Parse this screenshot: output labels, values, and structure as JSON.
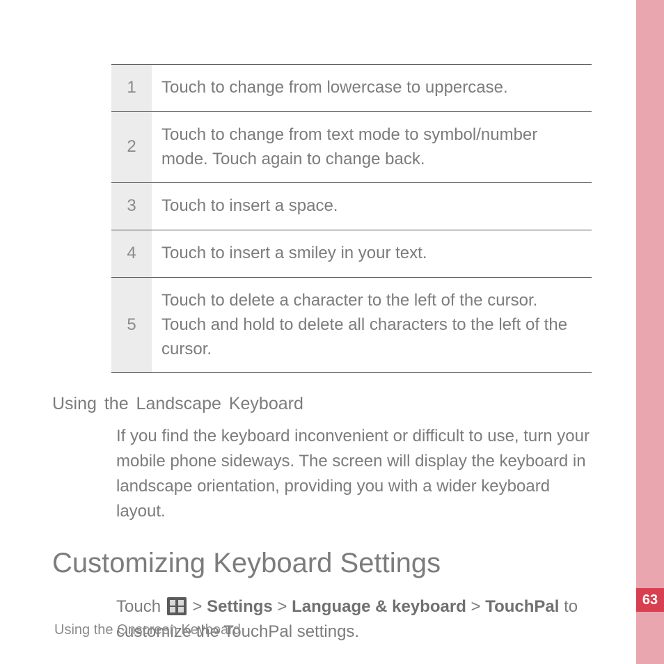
{
  "table": {
    "rows": [
      {
        "num": "1",
        "text": "Touch to change from lowercase to uppercase."
      },
      {
        "num": "2",
        "text": "Touch to change from text mode to symbol/number mode. Touch again to change back."
      },
      {
        "num": "3",
        "text": "Touch to insert a space."
      },
      {
        "num": "4",
        "text": "Touch to insert a smiley in your text."
      },
      {
        "num": "5",
        "text": "Touch to delete a character to the left of the cursor. Touch and hold to delete all characters to the left of the cursor."
      }
    ]
  },
  "subheading": "Using  the  Landscape  Keyboard",
  "landscape_paragraph": "If you find the keyboard inconvenient or difficult to use, turn your mobile phone sideways. The screen will display the keyboard in landscape orientation, providing you with a wider keyboard layout.",
  "section_title": "Customizing Keyboard Settings",
  "settings_paragraph": {
    "lead": "Touch ",
    "sep1": " > ",
    "b1": "Settings",
    "sep2": " > ",
    "b2": "Language & keyboard",
    "sep3": " > ",
    "b3": "TouchPal",
    "tail": " to customize the TouchPal settings."
  },
  "footer": "Using the Onscreen Keyboard",
  "page_number": "63"
}
